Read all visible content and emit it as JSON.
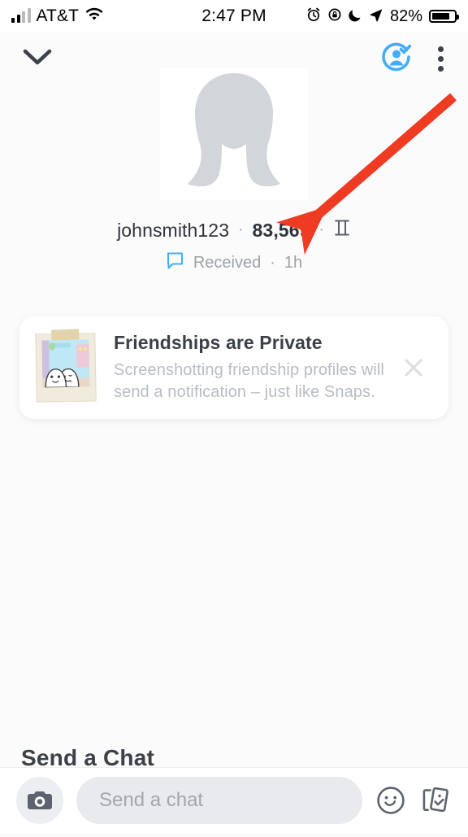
{
  "status_bar": {
    "carrier": "AT&T",
    "time": "2:47 PM",
    "battery_percent": "82%",
    "icons": [
      "signal-bars-icon",
      "wifi-icon",
      "alarm-clock-icon",
      "rotation-lock-icon",
      "do-not-disturb-moon-icon",
      "location-arrow-icon",
      "battery-icon"
    ]
  },
  "top_nav": {
    "back_icon": "chevron-down-icon",
    "friend_added_icon": "friend-added-check-icon",
    "more_icon": "more-options-vertical-dots-icon"
  },
  "profile": {
    "avatar_icon": "default-avatar-placeholder",
    "username": "johnsmith123",
    "separator": "·",
    "snapscore": "83,569",
    "zodiac_symbol": "♊",
    "zodiac_name": "gemini-zodiac-icon",
    "status_icon": "chat-bubble-icon",
    "status_text": "Received",
    "status_time": "1h"
  },
  "notice_card": {
    "thumbnail_icon": "polaroid-ghosts-icon",
    "title": "Friendships are Private",
    "body": "Screenshotting friendship profiles will send a notification – just like Snaps.",
    "close_icon": "close-x-icon"
  },
  "hidden_section": {
    "heading": "Send a Chat"
  },
  "chat_bar": {
    "camera_icon": "camera-icon",
    "input_placeholder": "Send a chat",
    "input_value": "",
    "sticker_icon": "smiley-face-icon",
    "cards_icon": "sticker-cards-icon"
  },
  "annotation": {
    "arrow_color": "#ee3b22",
    "arrow_points_at": "83,569"
  },
  "colors": {
    "accent_blue": "#43acfb",
    "text_dark": "#3c4148",
    "text_muted": "#b8bdc4",
    "background": "#fbfbfc",
    "card_background": "#ffffff"
  }
}
